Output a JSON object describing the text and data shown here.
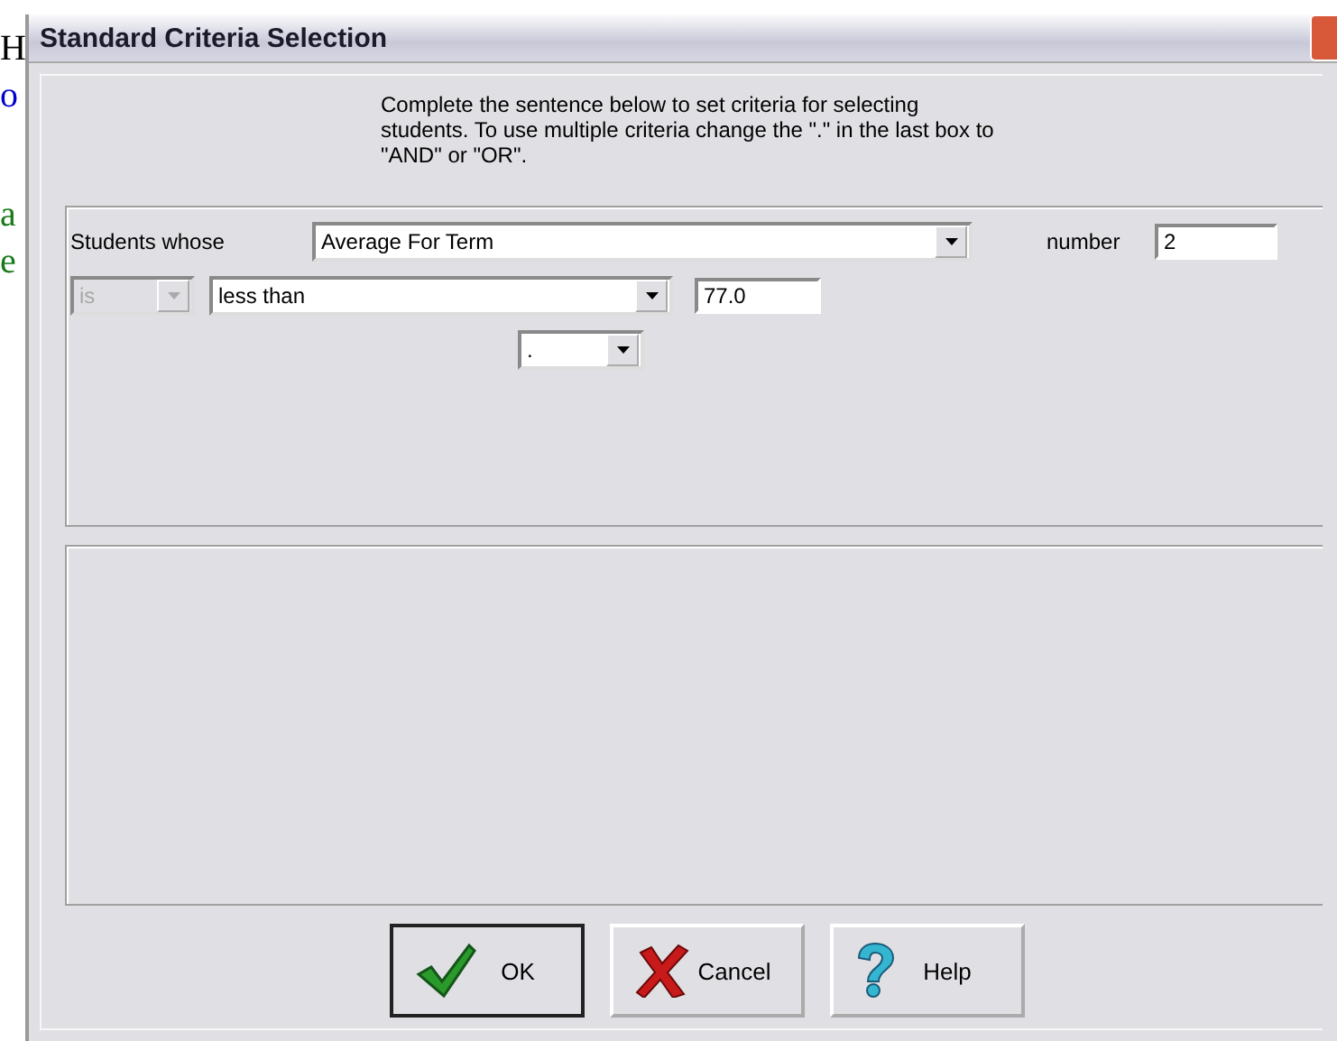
{
  "background_text": [
    {
      "text": "H",
      "color": "#000000"
    },
    {
      "text": "o",
      "color": "#0000cc"
    },
    {
      "text": "a",
      "color": "#1a7a1a"
    },
    {
      "text": "e",
      "color": "#1a7a1a"
    }
  ],
  "window": {
    "title": "Standard Criteria Selection"
  },
  "instructions": "Complete the sentence below to set criteria for selecting students.  To use multiple criteria change the \".\" in the last box to \"AND\" or \"OR\".",
  "criteria": {
    "subject_label": "Students whose",
    "subject": {
      "value": "Average For Term",
      "disabled": false
    },
    "number_label": "number",
    "number": "2",
    "verb": {
      "value": "is",
      "disabled": true
    },
    "comparison": {
      "value": "less than",
      "disabled": false
    },
    "threshold": "77.0",
    "connector": {
      "value": ".",
      "disabled": false
    }
  },
  "buttons": [
    {
      "label": "OK",
      "kind": "ok",
      "default": true
    },
    {
      "label": "Cancel",
      "kind": "cancel",
      "default": false
    },
    {
      "label": "Help",
      "kind": "help",
      "default": false
    }
  ]
}
